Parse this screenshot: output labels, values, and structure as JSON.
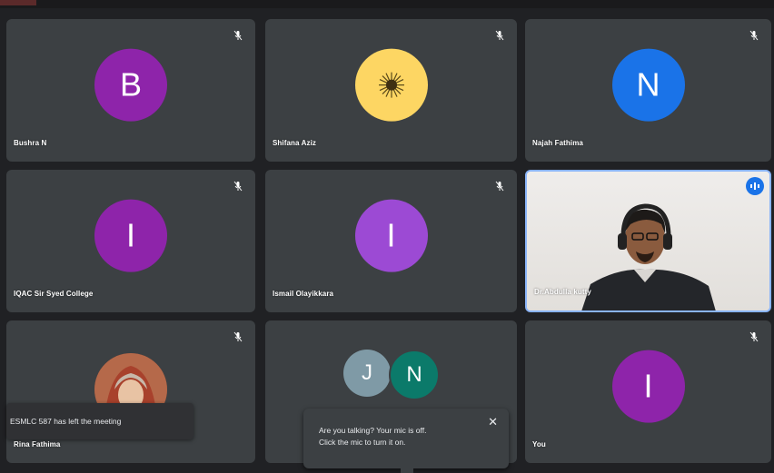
{
  "participants": [
    {
      "name": "Bushra N",
      "initial": "B",
      "color": "#8e24aa"
    },
    {
      "name": "Shifana Aziz",
      "initial": "",
      "color": "#fdd663"
    },
    {
      "name": "Najah Fathima",
      "initial": "N",
      "color": "#1a73e8"
    },
    {
      "name": "IQAC Sir Syed College",
      "initial": "I",
      "color": "#8e24aa"
    },
    {
      "name": "Ismail Olayikkara",
      "initial": "I",
      "color": "#9c4ad4"
    },
    {
      "name": "Dr.Abdulla kutty",
      "initial": "",
      "color": "#1a73e8"
    },
    {
      "name": "Rina Fathima",
      "initial": "",
      "color": "#7a3a2a"
    },
    {
      "name": "",
      "initial": "J",
      "initial2": "N",
      "color": "#7f9aa6",
      "color2": "#0b7a6a"
    },
    {
      "name": "You",
      "initial": "I",
      "color": "#8e24aa"
    }
  ],
  "notifications": {
    "left_meeting": "ESMLC 587 has left the meeting",
    "mic_line1": "Are you talking? Your mic is off.",
    "mic_line2": "Click the mic to turn it on.",
    "close": "✕"
  },
  "icons": {
    "mic_off": "mic-off-icon",
    "speaking": "audio-wave-icon"
  }
}
